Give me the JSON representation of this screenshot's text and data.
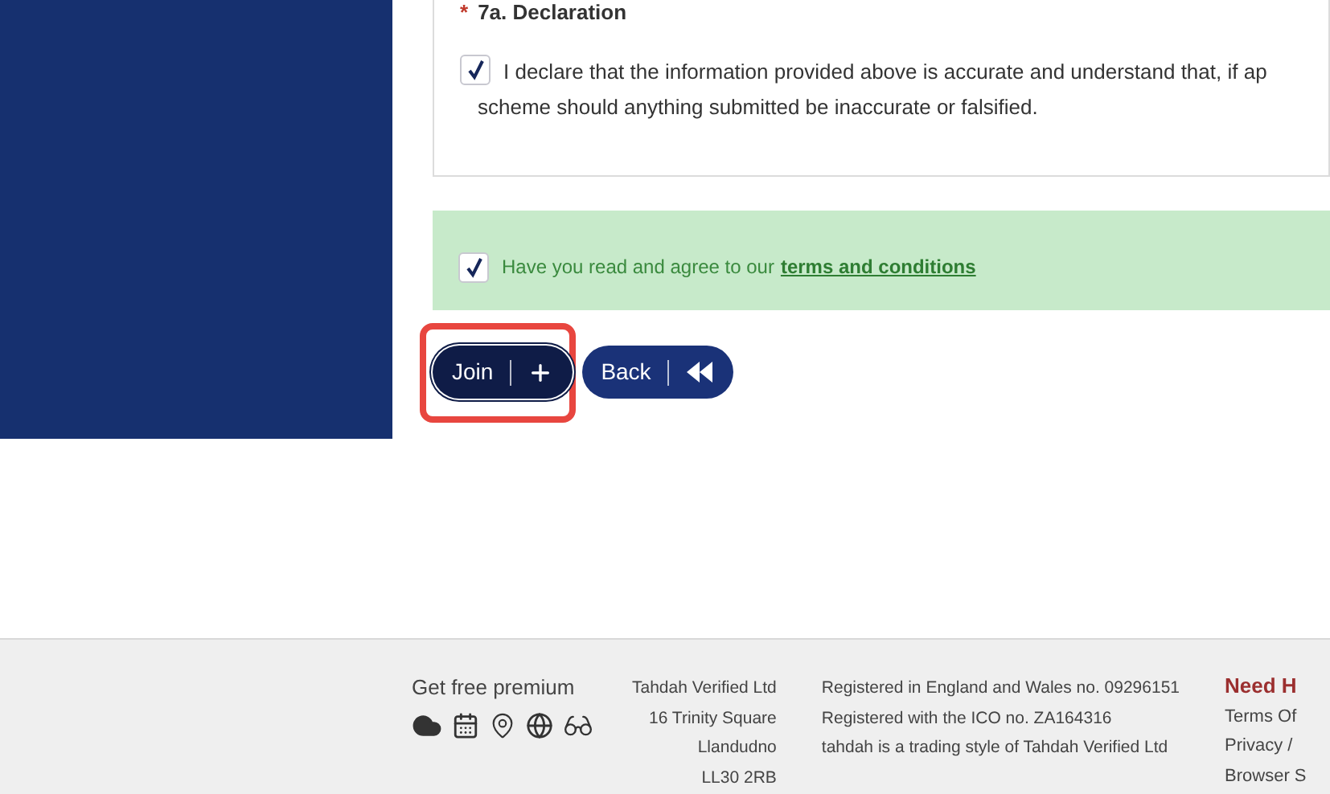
{
  "declaration": {
    "required_mark": "*",
    "heading": "7a. Declaration",
    "checked": true,
    "line_1": "I declare that the information provided above is accurate and understand that, if ap",
    "line_2": "scheme should anything submitted be inaccurate or falsified."
  },
  "terms": {
    "checked": true,
    "text": "Have you read and agree to our",
    "link": "terms and conditions"
  },
  "buttons": [
    {
      "label": "Join",
      "kind": "plus",
      "highlighted": true
    },
    {
      "label": "Back",
      "kind": "rewind",
      "highlighted": false
    }
  ],
  "footer": {
    "premium": "Get free premium",
    "address": [
      "Tahdah Verified Ltd",
      "16 Trinity Square",
      "Llandudno",
      "LL30 2RB"
    ],
    "registration": [
      "Registered in England and Wales no. 09296151",
      "Registered with the ICO no. ZA164316",
      "tahdah is a trading style of Tahdah Verified Ltd"
    ],
    "help_heading": "Need H",
    "links": [
      "Terms Of",
      "Privacy /",
      "Browser S"
    ]
  }
}
